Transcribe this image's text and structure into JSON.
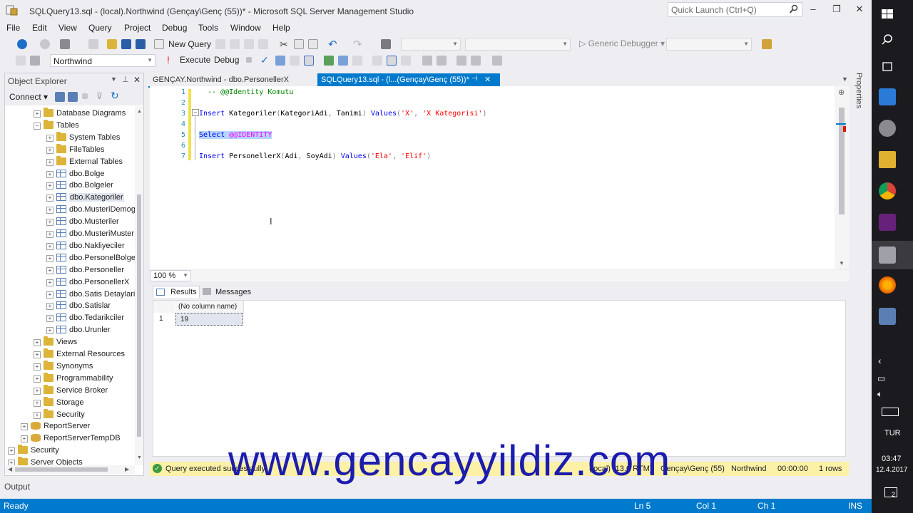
{
  "window": {
    "title": "SQLQuery13.sql - (local).Northwind (Gençay\\Genç (55))* - Microsoft SQL Server Management Studio",
    "quick_launch_placeholder": "Quick Launch (Ctrl+Q)"
  },
  "menu": [
    "File",
    "Edit",
    "View",
    "Query",
    "Project",
    "Debug",
    "Tools",
    "Window",
    "Help"
  ],
  "toolbar": {
    "new_query": "New Query",
    "database": "Northwind",
    "execute": "Execute",
    "debug": "Debug",
    "generic_debugger": "Generic Debugger"
  },
  "object_explorer": {
    "title": "Object Explorer",
    "connect": "Connect",
    "tree": [
      {
        "label": "Database Diagrams",
        "icon": "folder",
        "level": 2,
        "expander": "+"
      },
      {
        "label": "Tables",
        "icon": "folder",
        "level": 2,
        "expander": "-"
      },
      {
        "label": "System Tables",
        "icon": "folder",
        "level": 3,
        "expander": "+"
      },
      {
        "label": "FileTables",
        "icon": "folder",
        "level": 3,
        "expander": "+"
      },
      {
        "label": "External Tables",
        "icon": "folder",
        "level": 3,
        "expander": "+"
      },
      {
        "label": "dbo.Bolge",
        "icon": "table",
        "level": 3,
        "expander": "+"
      },
      {
        "label": "dbo.Bolgeler",
        "icon": "table",
        "level": 3,
        "expander": "+"
      },
      {
        "label": "dbo.Kategoriler",
        "icon": "table",
        "level": 3,
        "expander": "+",
        "selected": true
      },
      {
        "label": "dbo.MusteriDemog",
        "icon": "table",
        "level": 3,
        "expander": "+"
      },
      {
        "label": "dbo.Musteriler",
        "icon": "table",
        "level": 3,
        "expander": "+"
      },
      {
        "label": "dbo.MusteriMuster",
        "icon": "table",
        "level": 3,
        "expander": "+"
      },
      {
        "label": "dbo.Nakliyeciler",
        "icon": "table",
        "level": 3,
        "expander": "+"
      },
      {
        "label": "dbo.PersonelBolgel",
        "icon": "table",
        "level": 3,
        "expander": "+"
      },
      {
        "label": "dbo.Personeller",
        "icon": "table",
        "level": 3,
        "expander": "+"
      },
      {
        "label": "dbo.PersonellerX",
        "icon": "table",
        "level": 3,
        "expander": "+"
      },
      {
        "label": "dbo.Satis Detaylari",
        "icon": "table",
        "level": 3,
        "expander": "+"
      },
      {
        "label": "dbo.Satislar",
        "icon": "table",
        "level": 3,
        "expander": "+"
      },
      {
        "label": "dbo.Tedarikciler",
        "icon": "table",
        "level": 3,
        "expander": "+"
      },
      {
        "label": "dbo.Urunler",
        "icon": "table",
        "level": 3,
        "expander": "+"
      },
      {
        "label": "Views",
        "icon": "folder",
        "level": 2,
        "expander": "+"
      },
      {
        "label": "External Resources",
        "icon": "folder",
        "level": 2,
        "expander": "+"
      },
      {
        "label": "Synonyms",
        "icon": "folder",
        "level": 2,
        "expander": "+"
      },
      {
        "label": "Programmability",
        "icon": "folder",
        "level": 2,
        "expander": "+"
      },
      {
        "label": "Service Broker",
        "icon": "folder",
        "level": 2,
        "expander": "+"
      },
      {
        "label": "Storage",
        "icon": "folder",
        "level": 2,
        "expander": "+"
      },
      {
        "label": "Security",
        "icon": "folder",
        "level": 2,
        "expander": "+"
      },
      {
        "label": "ReportServer",
        "icon": "db",
        "level": 1,
        "expander": "+"
      },
      {
        "label": "ReportServerTempDB",
        "icon": "db",
        "level": 1,
        "expander": "+"
      },
      {
        "label": "Security",
        "icon": "folder",
        "level": 0,
        "expander": "+"
      },
      {
        "label": "Server Objects",
        "icon": "folder",
        "level": 0,
        "expander": "+"
      }
    ]
  },
  "tabs": [
    {
      "label": "GENÇAY.Northwind - dbo.PersonellerX",
      "active": false
    },
    {
      "label": "SQLQuery13.sql - (l...(Gençay\\Genç (55))*",
      "active": true
    }
  ],
  "editor": {
    "lines": [
      {
        "n": "1",
        "text": "  -- @@Identity Komutu"
      },
      {
        "n": "2",
        "text": ""
      },
      {
        "n": "3",
        "text": "Insert Kategoriler(KategoriAdi, Tanimi) Values('X', 'X Kategorisi')"
      },
      {
        "n": "4",
        "text": ""
      },
      {
        "n": "5",
        "text": "Select @@IDENTITY"
      },
      {
        "n": "6",
        "text": ""
      },
      {
        "n": "7",
        "text": "Insert PersonellerX(Adi, SoyAdi) Values('Ela', 'Elif')"
      }
    ],
    "zoom": "100 %"
  },
  "results": {
    "tabs": [
      "Results",
      "Messages"
    ],
    "columns": [
      "(No column name)"
    ],
    "rows": [
      [
        "1",
        "19"
      ]
    ]
  },
  "query_status": {
    "message": "Query executed successfully.",
    "server": "(local) (13.0 RTM)",
    "user": "Gençay\\Genç (55)",
    "database": "Northwind",
    "time": "00:00:00",
    "rows": "1 rows"
  },
  "output_label": "Output",
  "status": {
    "ready": "Ready",
    "ln": "Ln 5",
    "col": "Col 1",
    "ch": "Ch 1",
    "ins": "INS"
  },
  "side_tab": "Properties",
  "taskbar": {
    "lang": "TUR",
    "time": "03:47",
    "date": "12.4.2017",
    "notif": "2"
  },
  "watermark": "www.gencayyildiz.com"
}
